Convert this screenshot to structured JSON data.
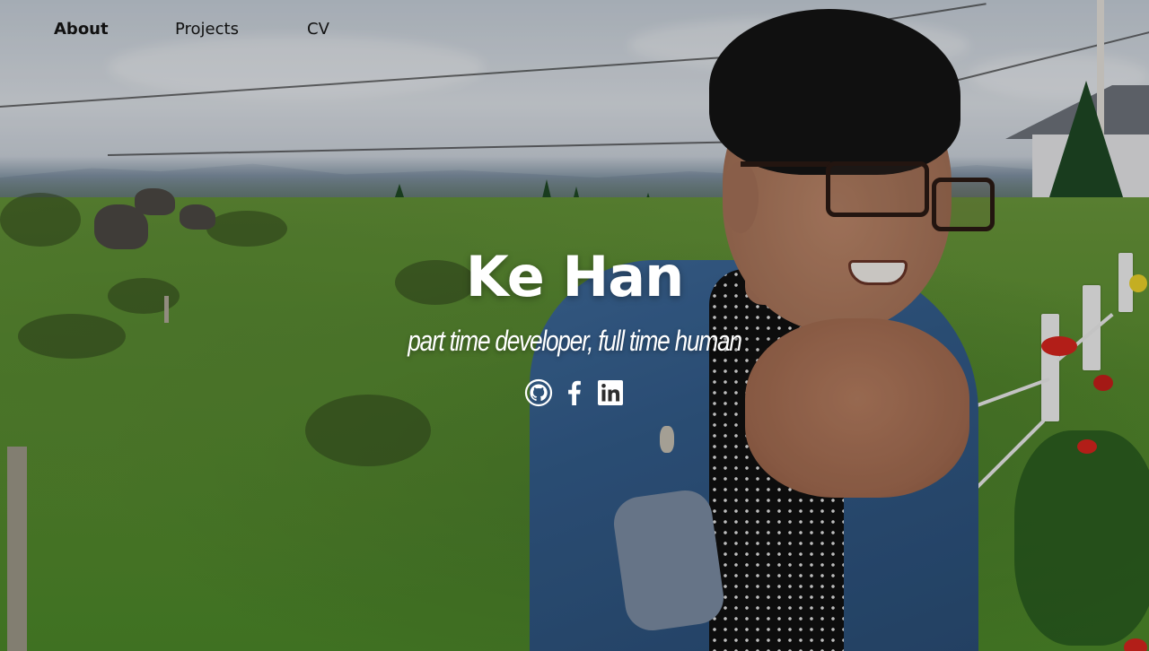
{
  "nav": {
    "items": [
      {
        "label": "About",
        "active": true
      },
      {
        "label": "Projects",
        "active": false
      },
      {
        "label": "CV",
        "active": false
      }
    ]
  },
  "hero": {
    "title": "Ke Han",
    "subtitle": "part time developer, full time human"
  },
  "social": {
    "icons": [
      "github-icon",
      "facebook-icon",
      "linkedin-icon"
    ]
  },
  "colors": {
    "text_light": "#ffffff",
    "nav_text": "#111111"
  }
}
